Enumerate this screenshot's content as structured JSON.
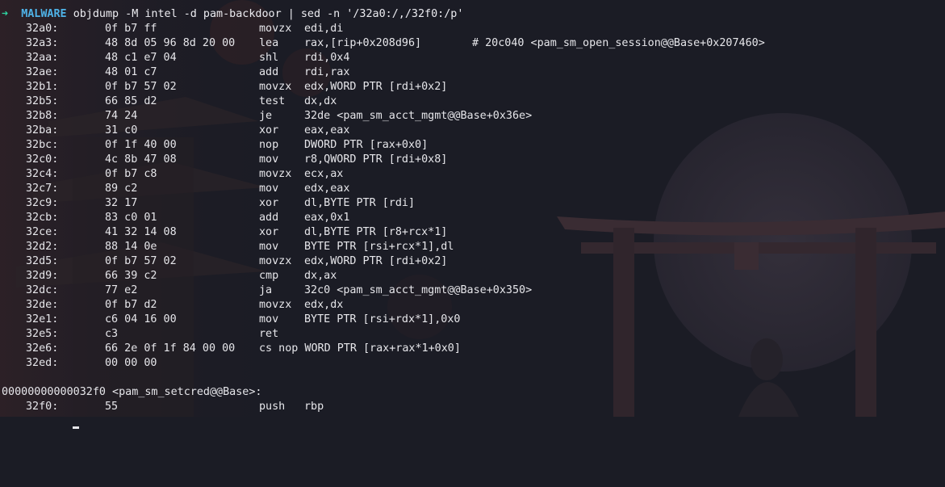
{
  "prompt": {
    "arrow": "➜",
    "dir": "MALWARE",
    "command": "objdump -M intel -d pam-backdoor | sed -n '/32a0:/,/32f0:/p'"
  },
  "listing": [
    {
      "addr": "32a0:",
      "bytes": "0f b7 ff",
      "mnemonic": "movzx",
      "operands": "edi,di",
      "comment": ""
    },
    {
      "addr": "32a3:",
      "bytes": "48 8d 05 96 8d 20 00",
      "mnemonic": "lea",
      "operands": "rax,[rip+0x208d96]",
      "comment": "# 20c040 <pam_sm_open_session@@Base+0x207460>"
    },
    {
      "addr": "32aa:",
      "bytes": "48 c1 e7 04",
      "mnemonic": "shl",
      "operands": "rdi,0x4",
      "comment": ""
    },
    {
      "addr": "32ae:",
      "bytes": "48 01 c7",
      "mnemonic": "add",
      "operands": "rdi,rax",
      "comment": ""
    },
    {
      "addr": "32b1:",
      "bytes": "0f b7 57 02",
      "mnemonic": "movzx",
      "operands": "edx,WORD PTR [rdi+0x2]",
      "comment": ""
    },
    {
      "addr": "32b5:",
      "bytes": "66 85 d2",
      "mnemonic": "test",
      "operands": "dx,dx",
      "comment": ""
    },
    {
      "addr": "32b8:",
      "bytes": "74 24",
      "mnemonic": "je",
      "operands": "32de <pam_sm_acct_mgmt@@Base+0x36e>",
      "comment": ""
    },
    {
      "addr": "32ba:",
      "bytes": "31 c0",
      "mnemonic": "xor",
      "operands": "eax,eax",
      "comment": ""
    },
    {
      "addr": "32bc:",
      "bytes": "0f 1f 40 00",
      "mnemonic": "nop",
      "operands": "DWORD PTR [rax+0x0]",
      "comment": ""
    },
    {
      "addr": "32c0:",
      "bytes": "4c 8b 47 08",
      "mnemonic": "mov",
      "operands": "r8,QWORD PTR [rdi+0x8]",
      "comment": ""
    },
    {
      "addr": "32c4:",
      "bytes": "0f b7 c8",
      "mnemonic": "movzx",
      "operands": "ecx,ax",
      "comment": ""
    },
    {
      "addr": "32c7:",
      "bytes": "89 c2",
      "mnemonic": "mov",
      "operands": "edx,eax",
      "comment": ""
    },
    {
      "addr": "32c9:",
      "bytes": "32 17",
      "mnemonic": "xor",
      "operands": "dl,BYTE PTR [rdi]",
      "comment": ""
    },
    {
      "addr": "32cb:",
      "bytes": "83 c0 01",
      "mnemonic": "add",
      "operands": "eax,0x1",
      "comment": ""
    },
    {
      "addr": "32ce:",
      "bytes": "41 32 14 08",
      "mnemonic": "xor",
      "operands": "dl,BYTE PTR [r8+rcx*1]",
      "comment": ""
    },
    {
      "addr": "32d2:",
      "bytes": "88 14 0e",
      "mnemonic": "mov",
      "operands": "BYTE PTR [rsi+rcx*1],dl",
      "comment": ""
    },
    {
      "addr": "32d5:",
      "bytes": "0f b7 57 02",
      "mnemonic": "movzx",
      "operands": "edx,WORD PTR [rdi+0x2]",
      "comment": ""
    },
    {
      "addr": "32d9:",
      "bytes": "66 39 c2",
      "mnemonic": "cmp",
      "operands": "dx,ax",
      "comment": ""
    },
    {
      "addr": "32dc:",
      "bytes": "77 e2",
      "mnemonic": "ja",
      "operands": "32c0 <pam_sm_acct_mgmt@@Base+0x350>",
      "comment": ""
    },
    {
      "addr": "32de:",
      "bytes": "0f b7 d2",
      "mnemonic": "movzx",
      "operands": "edx,dx",
      "comment": ""
    },
    {
      "addr": "32e1:",
      "bytes": "c6 04 16 00",
      "mnemonic": "mov",
      "operands": "BYTE PTR [rsi+rdx*1],0x0",
      "comment": ""
    },
    {
      "addr": "32e5:",
      "bytes": "c3",
      "mnemonic": "ret",
      "operands": "",
      "comment": ""
    },
    {
      "addr": "32e6:",
      "bytes": "66 2e 0f 1f 84 00 00",
      "mnemonic": "cs nop WORD PTR [rax+rax*1+0x0]",
      "operands": "",
      "comment": ""
    },
    {
      "addr": "32ed:",
      "bytes": "00 00 00",
      "mnemonic": "",
      "operands": "",
      "comment": ""
    }
  ],
  "section_header": "00000000000032f0 <pam_sm_setcred@@Base>:",
  "tail": {
    "addr": "32f0:",
    "bytes": "55",
    "mnemonic": "push",
    "operands": "rbp"
  },
  "colors": {
    "background": "#1b1c25",
    "prompt_arrow": "#2fd6a2",
    "prompt_dir": "#4fb3e8",
    "text": "#e6e6ea"
  }
}
